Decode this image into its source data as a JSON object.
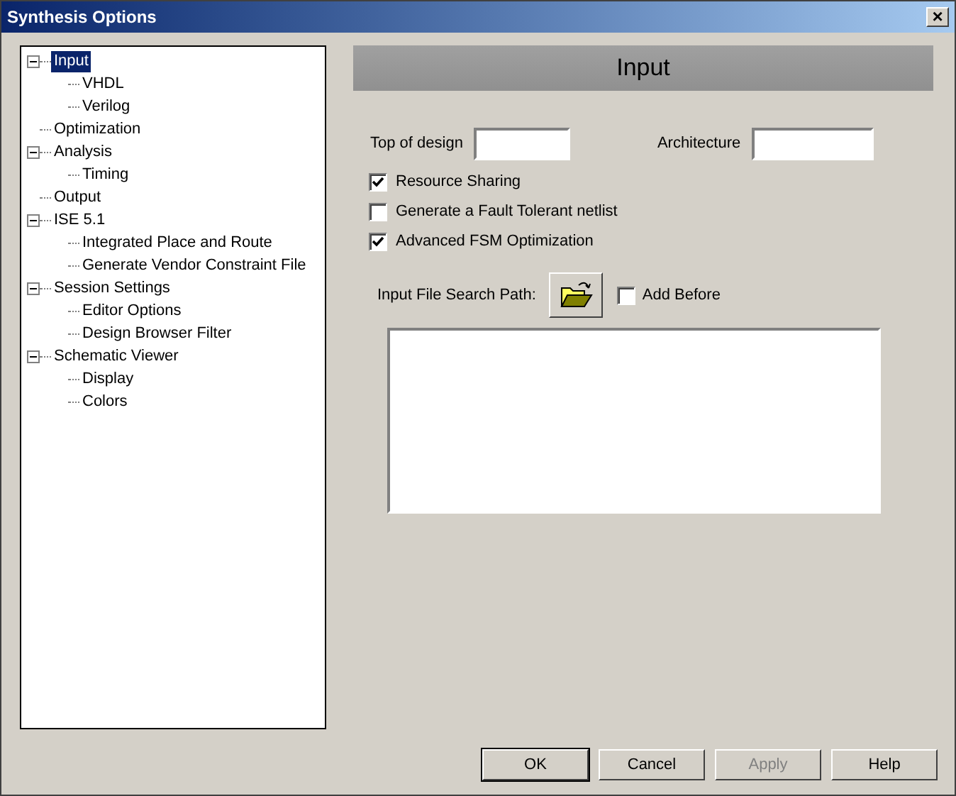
{
  "window": {
    "title": "Synthesis Options",
    "close": "×"
  },
  "tree": [
    {
      "label": "Input",
      "selected": true,
      "expanded": true,
      "children": [
        {
          "label": "VHDL",
          "selected": false
        },
        {
          "label": "Verilog",
          "selected": false
        }
      ]
    },
    {
      "label": "Optimization",
      "selected": false
    },
    {
      "label": "Analysis",
      "selected": false,
      "expanded": true,
      "children": [
        {
          "label": "Timing",
          "selected": false
        }
      ]
    },
    {
      "label": "Output",
      "selected": false
    },
    {
      "label": "ISE 5.1",
      "selected": false,
      "expanded": true,
      "children": [
        {
          "label": "Integrated Place and Route",
          "selected": false
        },
        {
          "label": "Generate Vendor Constraint File",
          "selected": false
        }
      ]
    },
    {
      "label": "Session Settings",
      "selected": false,
      "expanded": true,
      "children": [
        {
          "label": "Editor Options",
          "selected": false
        },
        {
          "label": "Design Browser Filter",
          "selected": false
        }
      ]
    },
    {
      "label": "Schematic Viewer",
      "selected": false,
      "expanded": true,
      "children": [
        {
          "label": "Display",
          "selected": false
        },
        {
          "label": "Colors",
          "selected": false
        }
      ]
    }
  ],
  "panel": {
    "heading": "Input",
    "fields": [
      {
        "label": "Top of design"
      },
      {
        "label": "Architecture"
      }
    ],
    "options": [
      {
        "label": "Resource Sharing",
        "checked": true
      },
      {
        "label": "Generate a Fault Tolerant netlist",
        "checked": false
      },
      {
        "label": "Advanced FSM Optimization",
        "checked": true
      }
    ],
    "search_path": {
      "label": "Input File Search Path:",
      "add_before": {
        "label": "Add Before",
        "checked": false
      }
    }
  },
  "buttons": [
    {
      "label": "OK",
      "default": true,
      "disabled": false
    },
    {
      "label": "Cancel",
      "default": false,
      "disabled": false
    },
    {
      "label": "Apply",
      "default": false,
      "disabled": true
    },
    {
      "label": "Help",
      "default": false,
      "disabled": false
    }
  ]
}
